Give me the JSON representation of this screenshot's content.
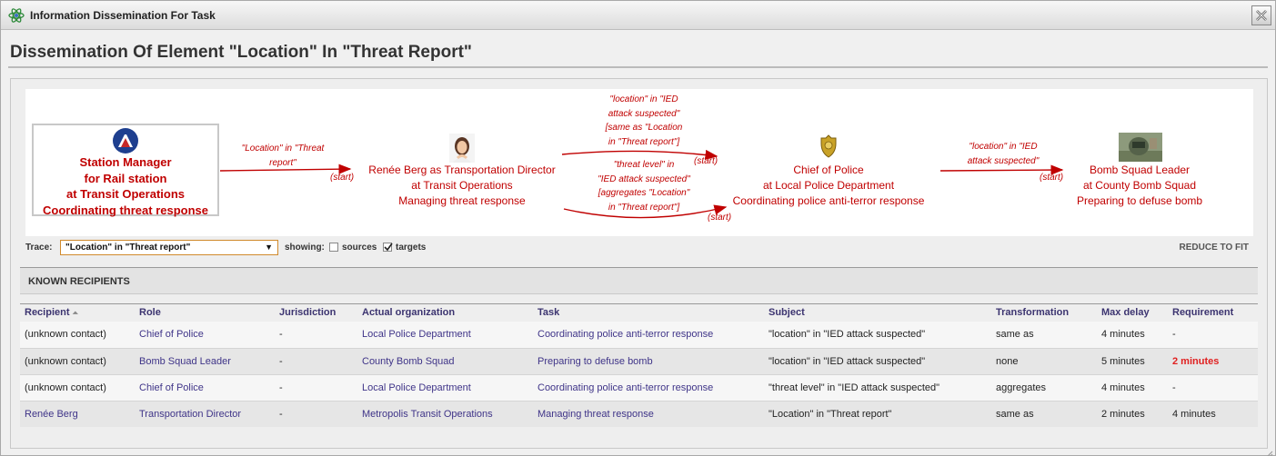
{
  "window": {
    "title": "Information Dissemination For Task",
    "app_icon": "atom-icon",
    "close_icon": "close-icon"
  },
  "heading": "Dissemination Of Element \"Location\" In \"Threat Report\"",
  "diagram": {
    "source": {
      "icon": "transit-logo-icon",
      "lines": [
        "Station Manager",
        "for Rail station",
        "at Transit Operations",
        "Coordinating threat response"
      ]
    },
    "nodes": [
      {
        "icon": "person-avatar-icon",
        "lines": [
          "Renée Berg as Transportation Director",
          "at Transit Operations",
          "Managing threat response"
        ]
      },
      {
        "icon": "police-badge-icon",
        "lines": [
          "Chief of Police",
          "at Local Police Department",
          "Coordinating police anti-terror response"
        ]
      },
      {
        "icon": "bomb-squad-photo-icon",
        "lines": [
          "Bomb Squad Leader",
          "at County Bomb Squad",
          "Preparing to defuse bomb"
        ]
      }
    ],
    "edges": [
      {
        "label": [
          "\"Location\" in \"Threat",
          "report\""
        ],
        "start": "(start)"
      },
      {
        "label": [
          "\"location\" in \"IED",
          "attack suspected\"",
          "[same as \"Location",
          "in \"Threat report\"]"
        ],
        "start": "(start)"
      },
      {
        "label": [
          "\"threat level\" in",
          "\"IED attack suspected\"",
          "[aggregates \"Location\"",
          "in \"Threat report\"]"
        ],
        "start": "(start)"
      },
      {
        "label": [
          "\"location\" in \"IED",
          "attack suspected\""
        ],
        "start": "(start)"
      }
    ]
  },
  "trace": {
    "label": "Trace:",
    "selected": "\"Location\" in \"Threat report\"",
    "showing_label": "showing:",
    "sources_label": "sources",
    "sources_checked": false,
    "targets_label": "targets",
    "targets_checked": true,
    "reduce_label": "REDUCE TO FIT"
  },
  "known_recipients": {
    "title": "KNOWN RECIPIENTS",
    "columns": [
      "Recipient",
      "Role",
      "Jurisdiction",
      "Actual organization",
      "Task",
      "Subject",
      "Transformation",
      "Max delay",
      "Requirement"
    ],
    "sort_icon": "sort-ascending-icon",
    "rows": [
      [
        "(unknown contact)",
        "Chief of Police",
        "-",
        "Local Police Department",
        "Coordinating police anti-terror response",
        "\"location\" in \"IED attack suspected\"",
        "same as",
        "4 minutes",
        "-"
      ],
      [
        "(unknown contact)",
        "Bomb Squad Leader",
        "-",
        "County Bomb Squad",
        "Preparing to defuse bomb",
        "\"location\" in \"IED attack suspected\"",
        "none",
        "5 minutes",
        "2 minutes"
      ],
      [
        "(unknown contact)",
        "Chief of Police",
        "-",
        "Local Police Department",
        "Coordinating police anti-terror response",
        "\"threat level\" in \"IED attack suspected\"",
        "aggregates",
        "4 minutes",
        "-"
      ],
      [
        "Renée Berg",
        "Transportation Director",
        "-",
        "Metropolis Transit Operations",
        "Managing threat response",
        "\"Location\" in \"Threat report\"",
        "same as",
        "2 minutes",
        "4 minutes"
      ]
    ]
  },
  "colors": {
    "accent_red": "#c00000",
    "link": "#3f3488",
    "warning": "#e02020"
  }
}
